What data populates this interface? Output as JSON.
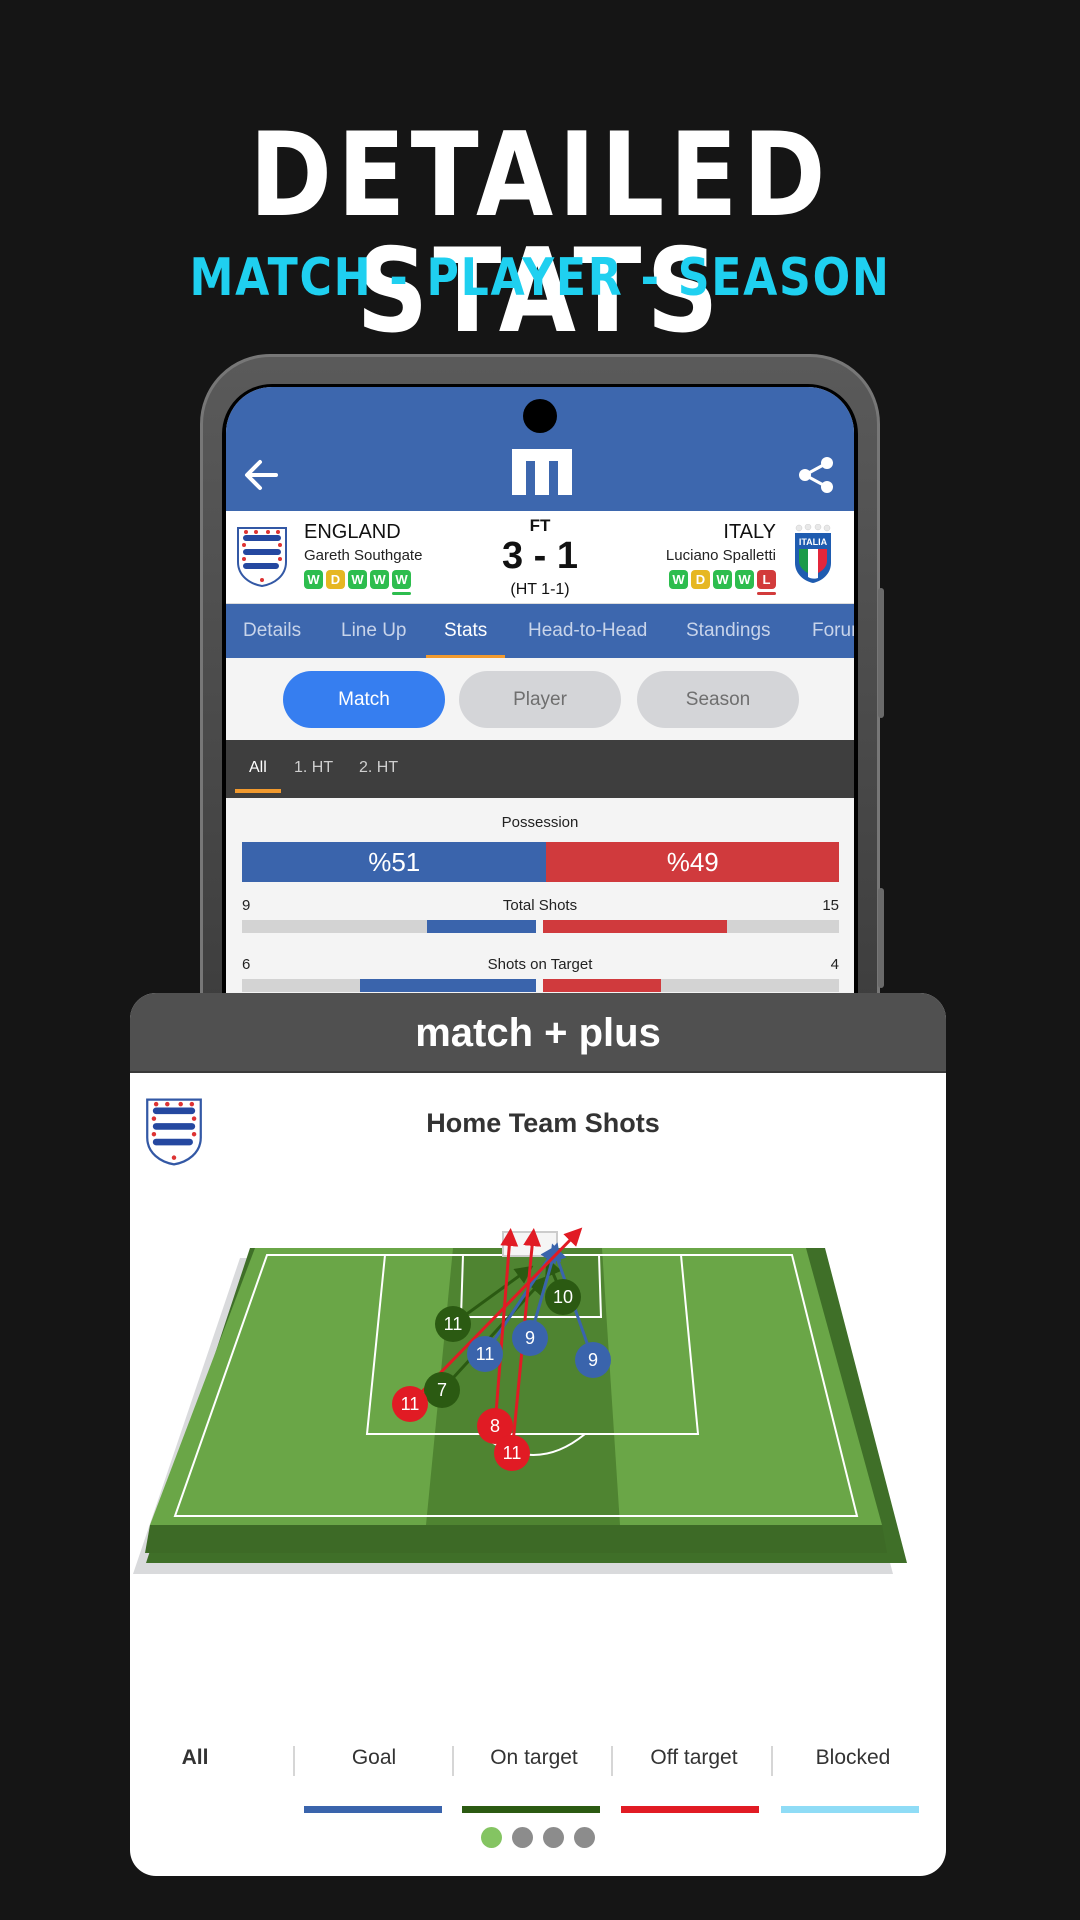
{
  "hero": {
    "title": "DETAILED STATS",
    "subtitle": "MATCH - PLAYER - SEASON",
    "subtitle_color": "#1fd0f0"
  },
  "app": {
    "logo_letter": "m",
    "back_icon": "arrow-left-icon",
    "share_icon": "share-icon",
    "brand_color": "#3d67ae"
  },
  "match": {
    "status": "FT",
    "score": "3 - 1",
    "halftime": "(HT 1-1)",
    "home": {
      "name": "ENGLAND",
      "coach": "Gareth Southgate",
      "form": [
        "W",
        "D",
        "W",
        "W",
        "W"
      ]
    },
    "away": {
      "name": "ITALY",
      "coach": "Luciano Spalletti",
      "form": [
        "W",
        "D",
        "W",
        "W",
        "L"
      ]
    },
    "form_colors": {
      "W": "#2dbd4e",
      "D": "#e6b722",
      "L": "#d23b3b"
    }
  },
  "tabs": [
    {
      "label": "Details",
      "active": false
    },
    {
      "label": "Line Up",
      "active": false
    },
    {
      "label": "Stats",
      "active": true
    },
    {
      "label": "Head-to-Head",
      "active": false
    },
    {
      "label": "Standings",
      "active": false
    },
    {
      "label": "Forum",
      "active": false
    }
  ],
  "segments": [
    {
      "label": "Match",
      "active": true
    },
    {
      "label": "Player",
      "active": false
    },
    {
      "label": "Season",
      "active": false
    }
  ],
  "periods": [
    {
      "label": "All",
      "active": true
    },
    {
      "label": "1. HT",
      "active": false
    },
    {
      "label": "2. HT",
      "active": false
    }
  ],
  "stats": {
    "possession": {
      "label": "Possession",
      "home": 51,
      "away": 49,
      "home_text": "%51",
      "away_text": "%49"
    },
    "rows": [
      {
        "label": "Total Shots",
        "home": "9",
        "away": "15",
        "home_fill": 0.37,
        "away_fill": 0.62
      },
      {
        "label": "Shots on Target",
        "home": "6",
        "away": "4",
        "home_fill": 0.6,
        "away_fill": 0.4
      }
    ],
    "home_color": "#3a64ac",
    "away_color": "#d03a3d"
  },
  "card": {
    "title": "match + plus",
    "subtitle": "Home Team Shots",
    "shots": [
      {
        "player": "10",
        "type": "on_target"
      },
      {
        "player": "11",
        "type": "on_target"
      },
      {
        "player": "7",
        "type": "on_target"
      },
      {
        "player": "11",
        "type": "goal"
      },
      {
        "player": "9",
        "type": "goal"
      },
      {
        "player": "9",
        "type": "goal"
      },
      {
        "player": "11",
        "type": "off_target"
      },
      {
        "player": "8",
        "type": "off_target"
      },
      {
        "player": "11",
        "type": "off_target"
      }
    ],
    "legend": [
      {
        "label": "All",
        "color": null
      },
      {
        "label": "Goal",
        "color": "#3a64ac"
      },
      {
        "label": "On target",
        "color": "#2b5a12"
      },
      {
        "label": "Off target",
        "color": "#e11b24"
      },
      {
        "label": "Blocked",
        "color": "#8fdcf6"
      }
    ],
    "pager": {
      "pages": 4,
      "current": 1
    }
  }
}
